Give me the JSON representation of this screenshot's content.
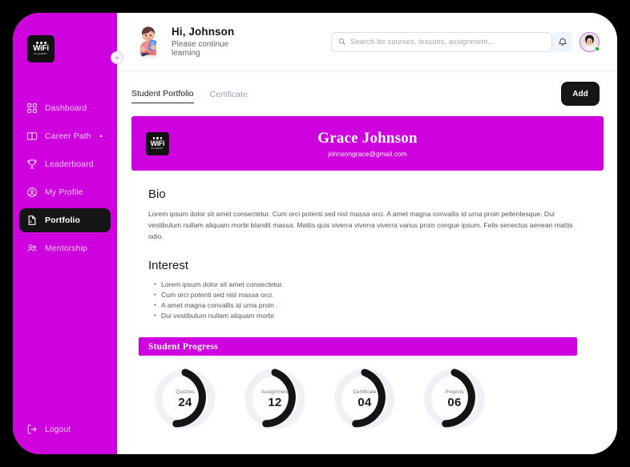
{
  "brand": {
    "logo_word": "WiFi",
    "logo_sub": "ACADEMY"
  },
  "sidebar": {
    "collapse_icon": "chevron-left-collapse-icon",
    "items": [
      {
        "label": "Dashboard",
        "icon": "grid-icon",
        "active": false,
        "chevron": ""
      },
      {
        "label": "Career Path",
        "icon": "book-icon",
        "active": false,
        "chevron": "▲"
      },
      {
        "label": "Leaderboard",
        "icon": "trophy-icon",
        "active": false,
        "chevron": ""
      },
      {
        "label": "My Profile",
        "icon": "user-circle-icon",
        "active": false,
        "chevron": ""
      },
      {
        "label": "Portfolio",
        "icon": "file-icon",
        "active": true,
        "chevron": ""
      },
      {
        "label": "Mentorship",
        "icon": "people-icon",
        "active": false,
        "chevron": ""
      }
    ],
    "logout_label": "Logout",
    "logout_icon": "logout-icon"
  },
  "header": {
    "greeting": "Hi, Johnson",
    "subtitle": "Please continue learning",
    "mascot_icon": "student-reading-illustration",
    "search": {
      "placeholder": "Search for courses, lessons, assignment...",
      "value": "",
      "icon": "search-icon"
    },
    "bell_icon": "bell-icon",
    "avatar_icon": "user-avatar",
    "status_color": "#19c23c"
  },
  "tabs": [
    {
      "label": "Student Portfolio",
      "active": true
    },
    {
      "label": "Certificate",
      "active": false
    }
  ],
  "add_button_label": "Add",
  "profile": {
    "name": "Grace Johnson",
    "email": "johnsongrace@gmail.com"
  },
  "bio": {
    "heading": "Bio",
    "text": "Lorem ipsum dolor sit amet consectetur. Cum orci potenti sed nisl massa orci. A amet magna convallis id urna proin pellentesque. Dui vestibulum nullam aliquam morbi blandit massa. Mattis quis viverra viverra viverra varius proin congue ipsum. Felis senectus aenean mattis odio."
  },
  "interest": {
    "heading": "Interest",
    "items": [
      "Lorem ipsum dolor sit amet consectetur.",
      "Cum orci potenti sed nisl massa orci.",
      "A amet magna convallis id urna proin .",
      "Dui vestibulum nullam aliquam morbi"
    ]
  },
  "progress": {
    "title": "Student Progress",
    "items": [
      {
        "label": "Quizzes",
        "value": "24"
      },
      {
        "label": "Assignment",
        "value": "12"
      },
      {
        "label": "Certificate",
        "value": "04"
      },
      {
        "label": "Projects",
        "value": "06"
      }
    ]
  },
  "colors": {
    "brand_magenta": "#ce00de",
    "dark": "#151515",
    "page_background": "#000000",
    "card": "#ffffff"
  }
}
